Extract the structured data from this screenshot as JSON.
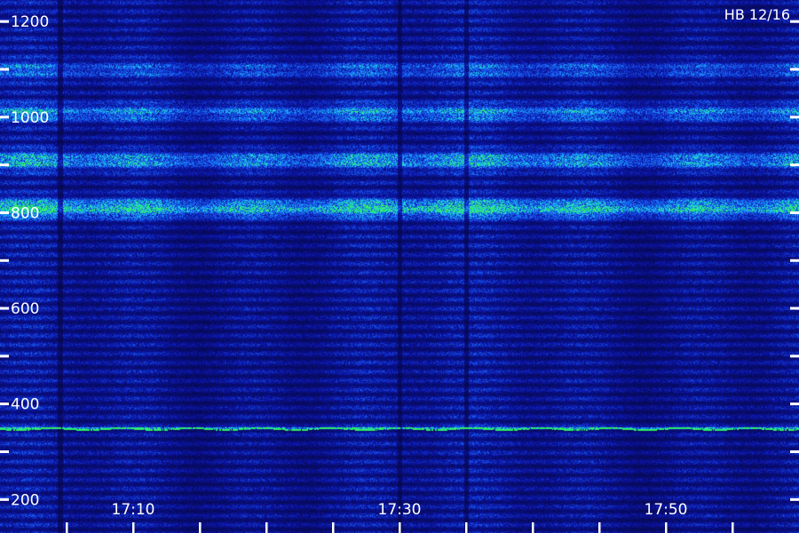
{
  "station_tag": "HB 12/16",
  "chart_data": {
    "type": "heatmap",
    "title": "",
    "xlabel": "",
    "ylabel": "",
    "y_range": [
      130,
      1245
    ],
    "y_tick_labels": [
      "200",
      "400",
      "600",
      "800",
      "1000",
      "1200"
    ],
    "y_label_values": [
      200,
      400,
      600,
      800,
      1000,
      1200
    ],
    "y_minor_tick_values": [
      200,
      300,
      400,
      500,
      600,
      700,
      800,
      900,
      1000,
      1100,
      1200
    ],
    "x_range_minutes": [
      0,
      60
    ],
    "x_tick_labels": [
      "17:10",
      "17:30",
      "17:50"
    ],
    "x_label_minutes": [
      10,
      30,
      50
    ],
    "x_tick_minutes": [
      5,
      10,
      15,
      20,
      25,
      30,
      35,
      40,
      45,
      50,
      55
    ],
    "colors": {
      "background": "#05063a",
      "low": "#0a0f9e",
      "mid": "#1f6bff",
      "high": "#22e0e0",
      "peak": "#2df06a",
      "labels": "#ffffff"
    },
    "bright_bands": [
      {
        "center": 350,
        "strength": 0.95,
        "label": "narrow green line"
      },
      {
        "center": 810,
        "strength": 0.85
      },
      {
        "center": 910,
        "strength": 0.6
      },
      {
        "center": 1010,
        "strength": 0.5
      },
      {
        "center": 1100,
        "strength": 0.35
      }
    ],
    "vertical_artifacts_minutes": [
      4.5,
      30,
      35
    ]
  }
}
